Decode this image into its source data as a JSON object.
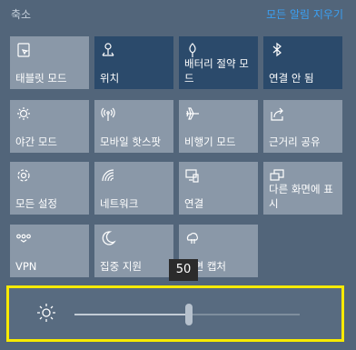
{
  "header": {
    "left": "축소",
    "right": "모든 알림 지우기"
  },
  "tiles": [
    {
      "label": "태블릿 모드",
      "icon": "tablet-mode-icon",
      "active": false
    },
    {
      "label": "위치",
      "icon": "location-icon",
      "active": true
    },
    {
      "label": "배터리 절약 모드",
      "icon": "battery-saver-icon",
      "active": true
    },
    {
      "label": "연결 안 됨",
      "icon": "bluetooth-icon",
      "active": true
    },
    {
      "label": "야간 모드",
      "icon": "night-light-icon",
      "active": false
    },
    {
      "label": "모바일 핫스팟",
      "icon": "mobile-hotspot-icon",
      "active": false
    },
    {
      "label": "비행기 모드",
      "icon": "airplane-icon",
      "active": false
    },
    {
      "label": "근거리 공유",
      "icon": "nearby-share-icon",
      "active": false
    },
    {
      "label": "모든 설정",
      "icon": "settings-gear-icon",
      "active": false
    },
    {
      "label": "네트워크",
      "icon": "network-icon",
      "active": false
    },
    {
      "label": "연결",
      "icon": "connect-icon",
      "active": false
    },
    {
      "label": "다른 화면에 표시",
      "icon": "project-icon",
      "active": false
    },
    {
      "label": "VPN",
      "icon": "vpn-icon",
      "active": false
    },
    {
      "label": "집중 지원",
      "icon": "focus-assist-icon",
      "active": false
    },
    {
      "label": "화면 캡처",
      "icon": "screen-snip-icon",
      "active": false
    }
  ],
  "brightness": {
    "value": "50",
    "level": 0.5,
    "icon": "brightness-sun-icon"
  }
}
